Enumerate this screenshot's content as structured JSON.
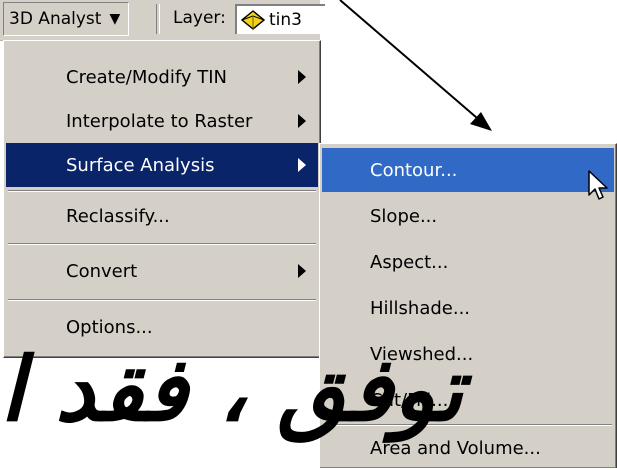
{
  "toolbar": {
    "menu_label": "3D Analyst",
    "layer_label": "Layer:",
    "layer_value": "tin3",
    "layer_icon": "tin-layer-icon"
  },
  "main_menu": {
    "items": [
      {
        "label": "Create/Modify TIN",
        "submenu": true
      },
      {
        "label": "Interpolate to Raster",
        "submenu": true
      },
      {
        "label": "Surface Analysis",
        "submenu": true,
        "highlighted": true
      },
      {
        "label": "Reclassify...",
        "submenu": false
      },
      {
        "label": "Convert",
        "submenu": true
      },
      {
        "label": "Options...",
        "submenu": false
      }
    ]
  },
  "surface_menu": {
    "items": [
      {
        "label": "Contour...",
        "highlighted": true
      },
      {
        "label": "Slope..."
      },
      {
        "label": "Aspect..."
      },
      {
        "label": "Hillshade..."
      },
      {
        "label": "Viewshed..."
      },
      {
        "label": "Cut/Fill..."
      },
      {
        "label": "Area and Volume..."
      }
    ]
  },
  "overlay": {
    "handwritten_text": "توفق ، فقد ا",
    "colors": {
      "menu_bg": "#d4d0c8",
      "highlight": "#0a246a",
      "highlight_sub": "#3169c6"
    }
  }
}
